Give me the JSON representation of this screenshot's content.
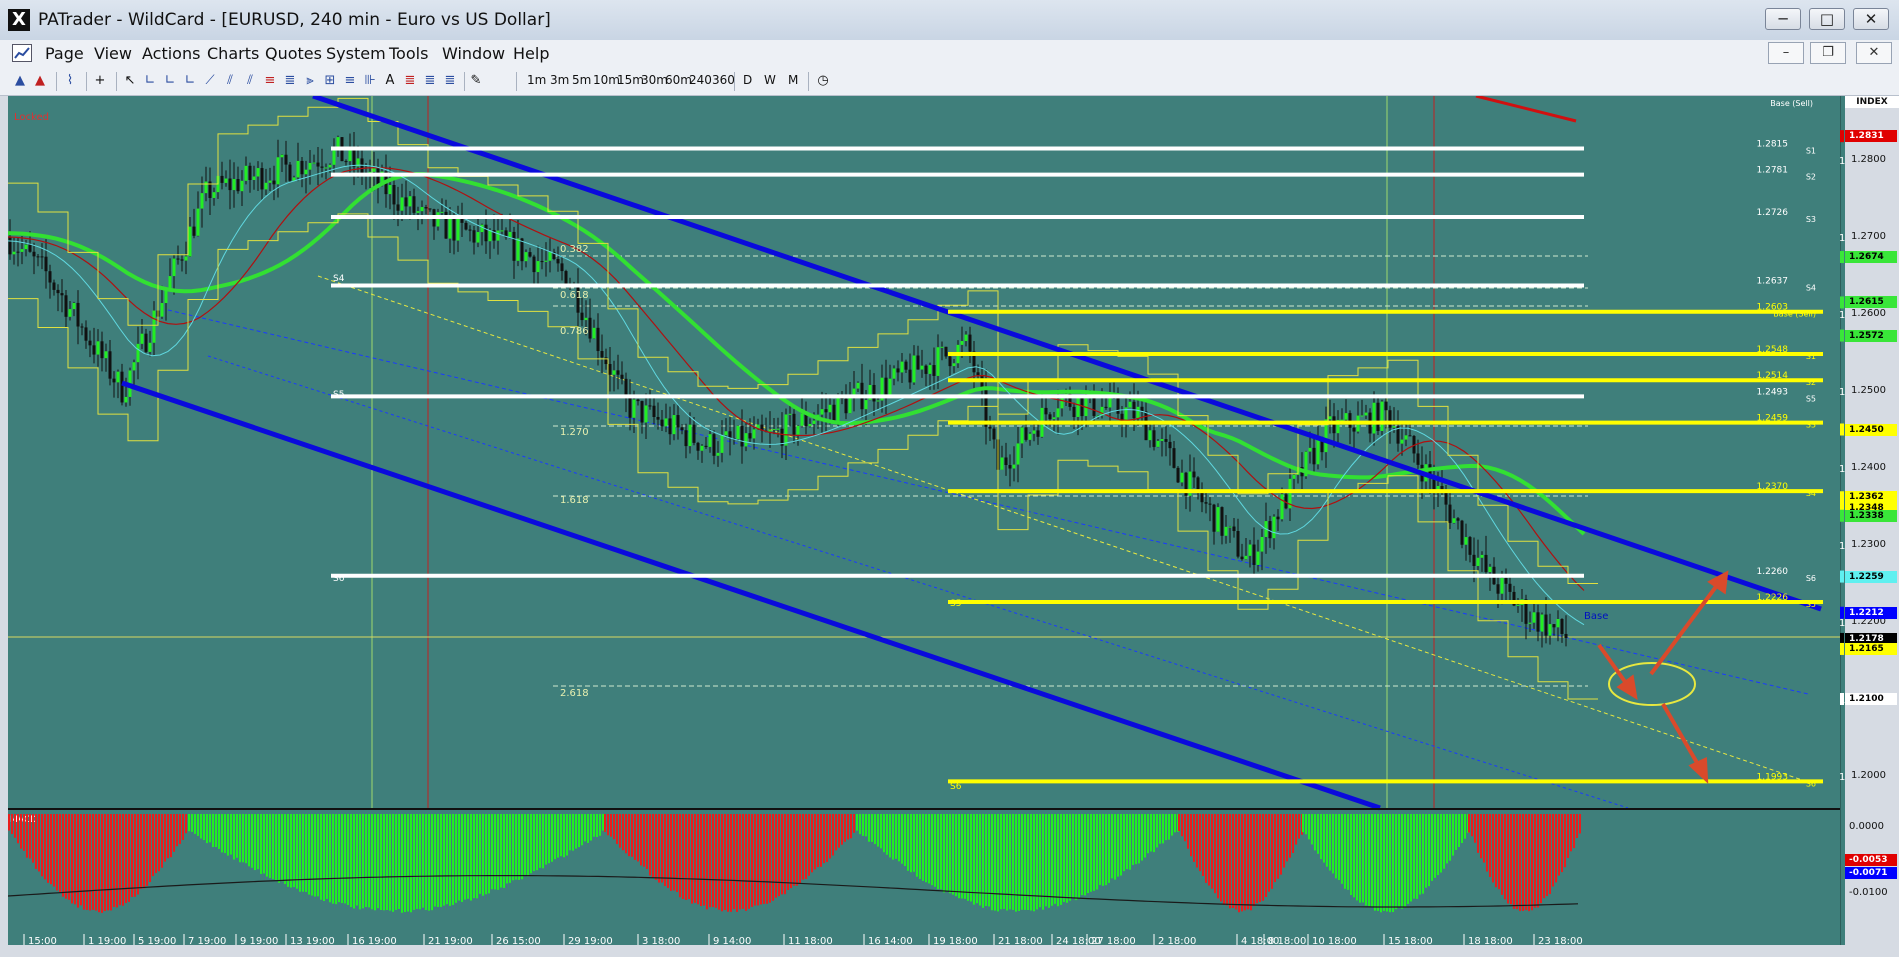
{
  "window": {
    "title": "PATrader - WildCard - [EURUSD, 240 min - Euro vs US Dollar]",
    "app_icon": "X",
    "minimize": "─",
    "maximize": "□",
    "close": "✕"
  },
  "menu": {
    "items": [
      "Page",
      "View",
      "Actions",
      "Charts",
      "Quotes",
      "System",
      "Tools",
      "Window",
      "Help"
    ],
    "mdi_minimize": "–",
    "mdi_restore": "❐",
    "mdi_close": "✕"
  },
  "toolbar": {
    "timeframes": [
      "1m",
      "3m",
      "5m",
      "10m",
      "15m",
      "30m",
      "60m",
      "240",
      "360"
    ],
    "periods": [
      "D",
      "W",
      "M"
    ]
  },
  "chart": {
    "locked_label": "Locked",
    "index_label": "INDEX",
    "macd_label": "MACD",
    "base_sell_label": "Base (Sell)",
    "base_label": "Base",
    "fib_labels": [
      {
        "text": "0.382"
      },
      {
        "text": "0.618"
      },
      {
        "text": "0.786"
      },
      {
        "text": "1.270"
      },
      {
        "text": "1.618"
      },
      {
        "text": "2.618"
      }
    ],
    "white_levels": [
      {
        "price": "1.2815",
        "tag": "S1"
      },
      {
        "price": "1.2781",
        "tag": "S2"
      },
      {
        "price": "1.2726",
        "tag": "S3"
      },
      {
        "price": "1.2637",
        "tag": "S4"
      },
      {
        "price": "1.2493",
        "tag": "S5"
      },
      {
        "price": "1.2260",
        "tag": "S6"
      }
    ],
    "yellow_levels": [
      {
        "price": "1.2603",
        "tag": "Base (Sell)"
      },
      {
        "price": "1.2548",
        "tag": "S1"
      },
      {
        "price": "1.2514",
        "tag": "S2"
      },
      {
        "price": "1.2459",
        "tag": "S3"
      },
      {
        "price": "1.2370",
        "tag": "S4"
      },
      {
        "price": "1.2226",
        "tag": "S5"
      },
      {
        "price": "1.1993",
        "tag": "S6"
      }
    ],
    "left_tags": [
      "S4",
      "S5",
      "S6",
      "S5",
      "S6"
    ],
    "price_axis": [
      "1.2800",
      "1.2700",
      "1.2600",
      "1.2500",
      "1.2400",
      "1.2300",
      "1.2200",
      "1.2100",
      "1.2000"
    ],
    "price_badges": [
      {
        "text": "1.2831",
        "bg": "#e00000",
        "fg": "#ffffff"
      },
      {
        "text": "1.2674",
        "bg": "#39e639",
        "fg": "#000000"
      },
      {
        "text": "1.2615",
        "bg": "#39e639",
        "fg": "#000000"
      },
      {
        "text": "1.2572",
        "bg": "#39e639",
        "fg": "#000000"
      },
      {
        "text": "1.2450",
        "bg": "#ffff00",
        "fg": "#000000"
      },
      {
        "text": "1.2362",
        "bg": "#ffff00",
        "fg": "#000000"
      },
      {
        "text": "1.2348",
        "bg": "#ffff00",
        "fg": "#000000"
      },
      {
        "text": "1.2338",
        "bg": "#39e639",
        "fg": "#000000"
      },
      {
        "text": "1.2259",
        "bg": "#5ff0f0",
        "fg": "#000000"
      },
      {
        "text": "1.2212",
        "bg": "#0000ff",
        "fg": "#ffffff"
      },
      {
        "text": "1.2178",
        "bg": "#000000",
        "fg": "#ffffff"
      },
      {
        "text": "1.2165",
        "bg": "#ffff00",
        "fg": "#000000"
      },
      {
        "text": "1.2100",
        "bg": "#ffffff",
        "fg": "#000000"
      }
    ],
    "macd_axis": [
      "0.0000",
      "-0.0100"
    ],
    "macd_badges": [
      {
        "text": "-0.0053",
        "bg": "#e00000",
        "fg": "#ffffff"
      },
      {
        "text": "-0.0071",
        "bg": "#0000ff",
        "fg": "#ffffff"
      }
    ],
    "time_axis": [
      "15:00",
      "1 19:00",
      "5 19:00",
      "7 19:00",
      "9 19:00",
      "13 19:00",
      "16 19:00",
      "21 19:00",
      "26 15:00",
      "29 19:00",
      "3 18:00",
      "9 14:00",
      "11 18:00",
      "16 14:00",
      "19 18:00",
      "21 18:00",
      "24 18:00",
      "27 18:00",
      "2 18:00",
      "4 18:00",
      "8 18:00",
      "10 18:00",
      "15 18:00",
      "18 18:00",
      "23 18:00"
    ]
  },
  "colors": {
    "chart_bg": "#3f7f7b",
    "channel": "#0000e6",
    "support_white": "#ffffff",
    "support_yellow": "#ffff00",
    "ma_green": "#32e032",
    "ma_red": "#b01010",
    "ma_cyan": "#60d8e0",
    "macd_up": "#22ee22",
    "macd_down": "#e81e1e",
    "arrow": "#d94a2b"
  }
}
